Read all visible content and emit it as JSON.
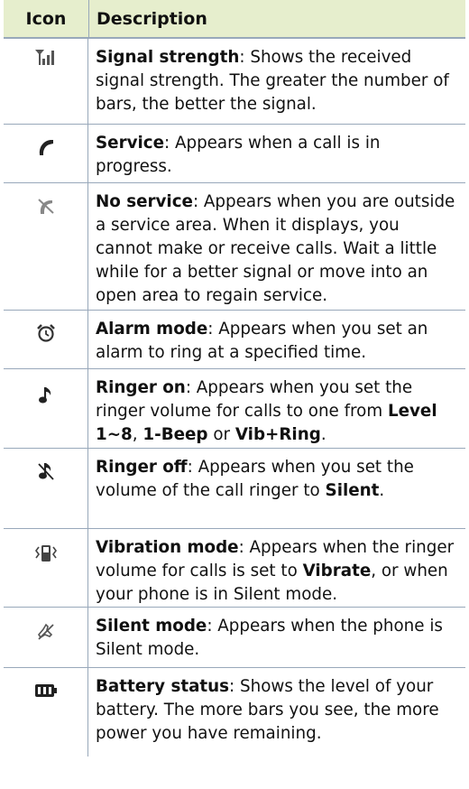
{
  "header": {
    "icon": "Icon",
    "description": "Description"
  },
  "rows": [
    {
      "icon": "signal-strength-icon",
      "title": "Signal strength",
      "text": ": Shows the received signal strength. The greater the number of bars, the better the signal."
    },
    {
      "icon": "service-call-icon",
      "title": "Service",
      "text": ": Appears when a call is in progress."
    },
    {
      "icon": "no-service-icon",
      "title": "No service",
      "text": ": Appears when you are outside a service area. When it displays, you cannot make or receive calls. Wait a little while for a better signal or move into an open area to regain service."
    },
    {
      "icon": "alarm-clock-icon",
      "title": "Alarm mode",
      "text": ": Appears when you set an alarm to ring at a specified time."
    },
    {
      "icon": "ringer-on-icon",
      "title": "Ringer on",
      "t1": ": Appears when you set the ringer volume for calls to one from ",
      "b1": "Level 1~8",
      "t2": ", ",
      "b2": "1-Beep",
      "t3": " or ",
      "b3": "Vib+Ring",
      "t4": "."
    },
    {
      "icon": "ringer-off-icon",
      "title": "Ringer off",
      "t1": ": Appears when you set the volume of the call ringer to ",
      "b1": "Silent",
      "t2": "."
    },
    {
      "icon": "vibration-mode-icon",
      "title": "Vibration mode",
      "t1": ": Appears when the ringer volume for calls is set to ",
      "b1": "Vibrate",
      "t2": ", or when your phone is in Silent mode."
    },
    {
      "icon": "silent-mode-icon",
      "title": "Silent mode",
      "text": ": Appears when the phone is Silent mode."
    },
    {
      "icon": "battery-status-icon",
      "title": "Battery status",
      "text": ": Shows the level of your battery. The more bars you see, the more power you have remaining."
    }
  ]
}
